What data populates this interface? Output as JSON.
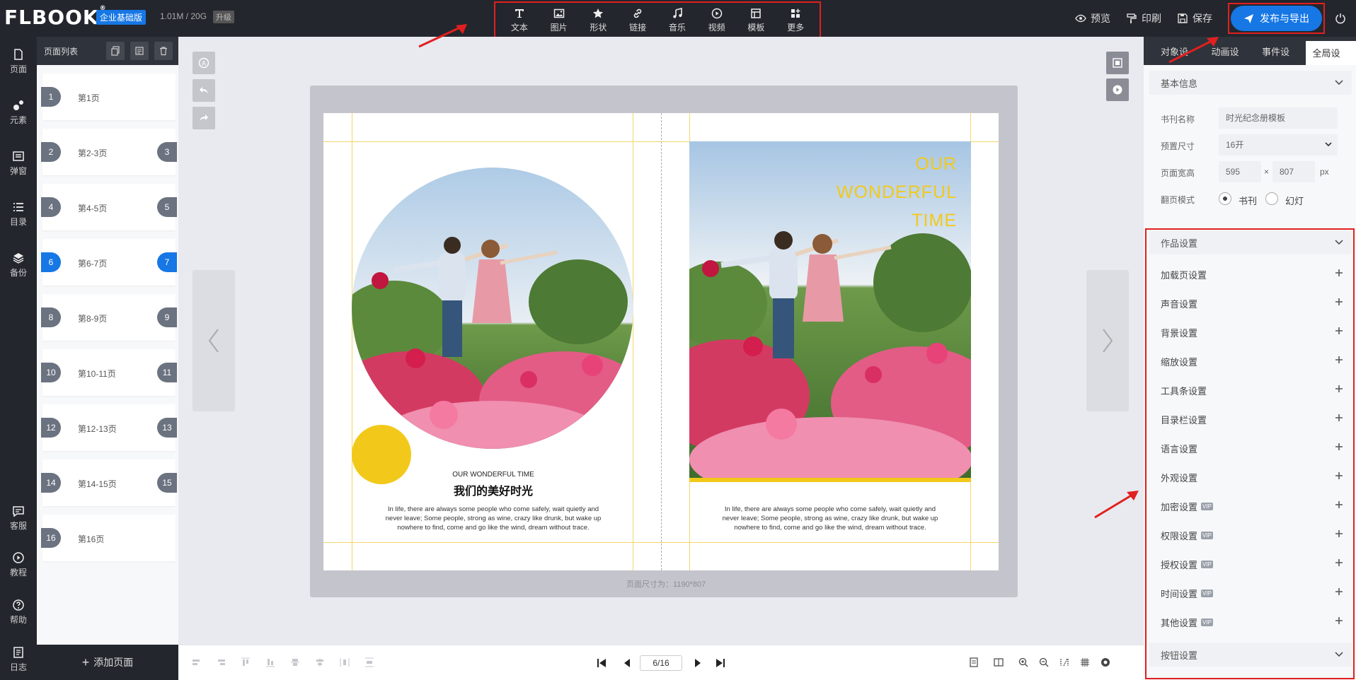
{
  "header": {
    "logo": "FLBOOK",
    "edition": "企业基础版",
    "storage": "1.01M / 20G",
    "upgrade": "升级",
    "tools": [
      {
        "label": "文本",
        "icon": "text-icon"
      },
      {
        "label": "图片",
        "icon": "image-icon"
      },
      {
        "label": "形状",
        "icon": "star-icon"
      },
      {
        "label": "链接",
        "icon": "link-icon"
      },
      {
        "label": "音乐",
        "icon": "music-icon"
      },
      {
        "label": "视频",
        "icon": "video-icon"
      },
      {
        "label": "模板",
        "icon": "template-icon"
      },
      {
        "label": "更多",
        "icon": "more-icon"
      }
    ],
    "preview": "预览",
    "print": "印刷",
    "save": "保存",
    "publish": "发布与导出"
  },
  "nav": {
    "items": [
      {
        "label": "页面",
        "icon": "page-icon"
      },
      {
        "label": "元素",
        "icon": "element-icon"
      },
      {
        "label": "弹窗",
        "icon": "popup-icon"
      },
      {
        "label": "目录",
        "icon": "catalog-icon"
      },
      {
        "label": "备份",
        "icon": "backup-icon"
      },
      {
        "label": "客服",
        "icon": "service-icon"
      },
      {
        "label": "教程",
        "icon": "tutorial-icon"
      },
      {
        "label": "帮助",
        "icon": "help-icon"
      },
      {
        "label": "日志",
        "icon": "log-icon"
      }
    ]
  },
  "pages": {
    "title": "页面列表",
    "rows": [
      {
        "left": "1",
        "label": "第1页",
        "right": ""
      },
      {
        "left": "2",
        "label": "第2-3页",
        "right": "3"
      },
      {
        "left": "4",
        "label": "第4-5页",
        "right": "5"
      },
      {
        "left": "6",
        "label": "第6-7页",
        "right": "7"
      },
      {
        "left": "8",
        "label": "第8-9页",
        "right": "9"
      },
      {
        "left": "10",
        "label": "第10-11页",
        "right": "11"
      },
      {
        "left": "12",
        "label": "第12-13页",
        "right": "13"
      },
      {
        "left": "14",
        "label": "第14-15页",
        "right": "15"
      },
      {
        "left": "16",
        "label": "第16页",
        "right": ""
      }
    ],
    "active_index": 3,
    "add": "添加页面"
  },
  "canvas": {
    "left_small": "OUR WONDERFUL TIME",
    "left_title": "我们的美好时光",
    "paragraph": "In life, there are always some people who come safely, wait quietly and never leave; Some people, strong as wine, crazy like drunk, but wake up nowhere to find, come and go like the wind, dream without trace.",
    "cover_lines": [
      "OUR",
      "WONDERFUL",
      "TIME"
    ],
    "size_note": "页面尺寸为：1190*807",
    "pager": "6/16"
  },
  "rpanel": {
    "tabs": [
      "对象设置",
      "动画设置",
      "事件设置",
      "全局设置"
    ],
    "active_tab": 3,
    "basic": {
      "title": "基本信息",
      "name_label": "书刊名称",
      "name_placeholder": "时光纪念册模板",
      "size_label": "预置尺寸",
      "size_value": "16开",
      "wh_label": "页面宽高",
      "width": "595",
      "times": "×",
      "height": "807",
      "unit": "px",
      "mode_label": "翻页模式",
      "mode_book": "书刊",
      "mode_slide": "幻灯"
    },
    "work_settings": "作品设置",
    "settings": [
      {
        "label": "加载页设置",
        "vip": ""
      },
      {
        "label": "声音设置",
        "vip": ""
      },
      {
        "label": "背景设置",
        "vip": ""
      },
      {
        "label": "缩放设置",
        "vip": ""
      },
      {
        "label": "工具条设置",
        "vip": ""
      },
      {
        "label": "目录栏设置",
        "vip": ""
      },
      {
        "label": "语言设置",
        "vip": ""
      },
      {
        "label": "外观设置",
        "vip": ""
      },
      {
        "label": "加密设置",
        "vip": "VIP"
      },
      {
        "label": "权限设置",
        "vip": "VIP"
      },
      {
        "label": "授权设置",
        "vip": "VIP"
      },
      {
        "label": "时间设置",
        "vip": "VIP"
      },
      {
        "label": "其他设置",
        "vip": "VIP"
      }
    ],
    "button_settings": "按钮设置"
  },
  "colors": {
    "accent": "#1677e5",
    "dark": "#23262d",
    "highlight": "#e02020",
    "cover_yellow": "#f2c91a"
  }
}
